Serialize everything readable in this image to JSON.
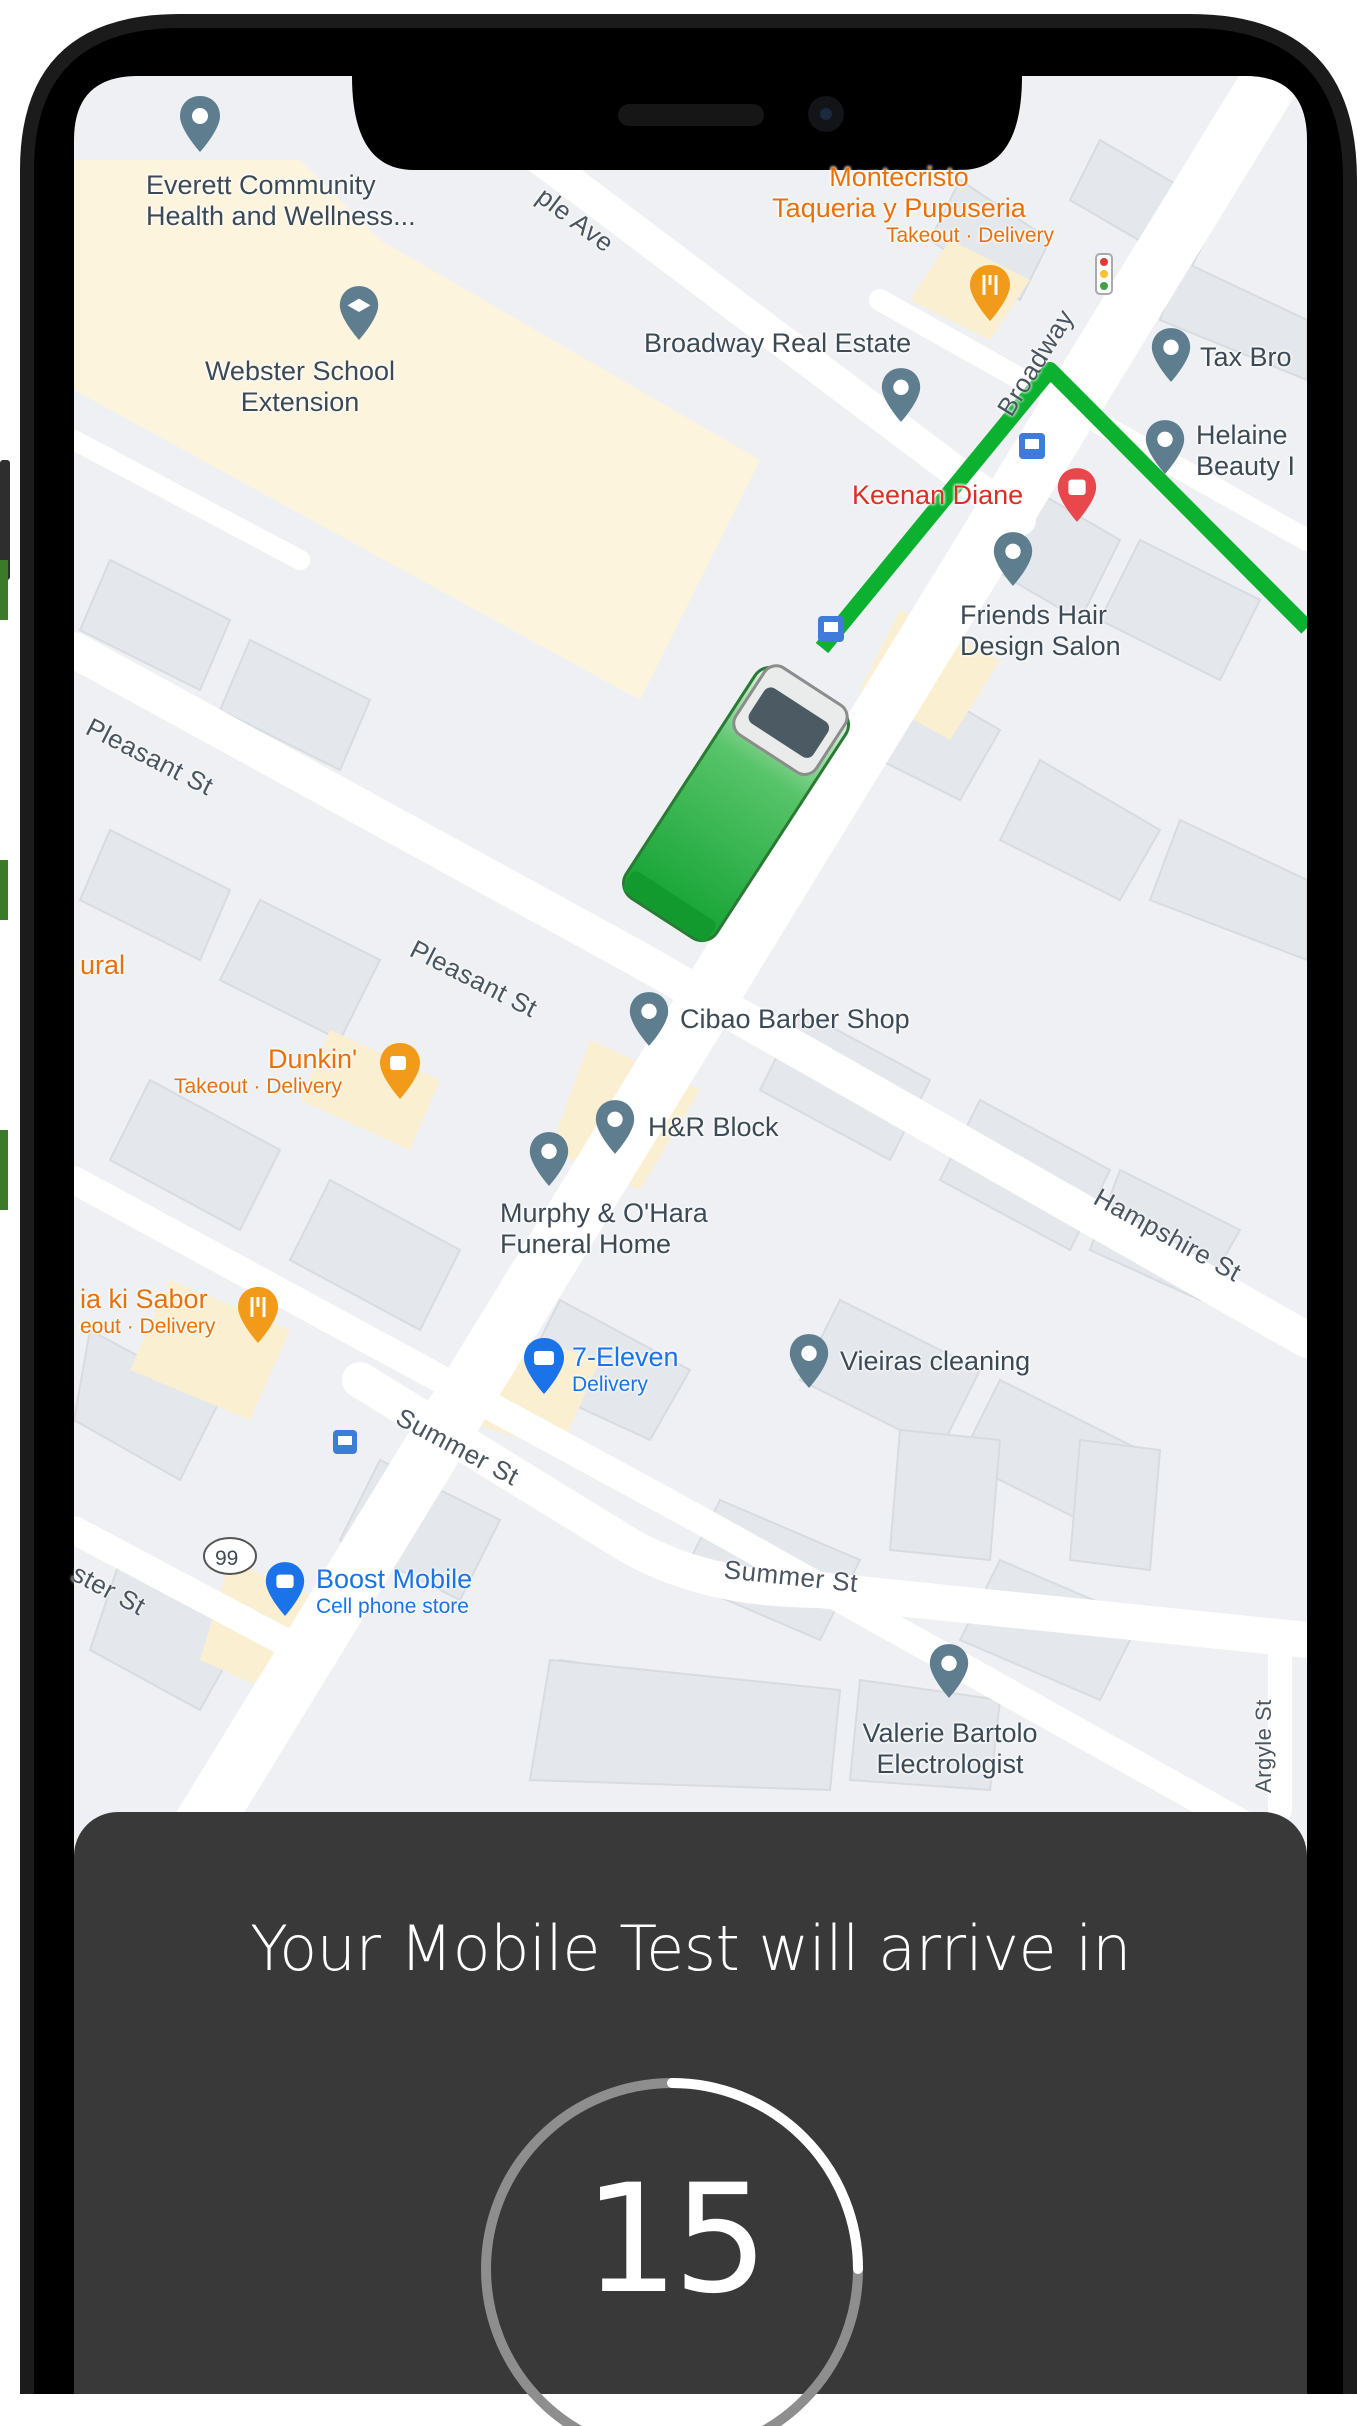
{
  "map": {
    "places": {
      "everett": [
        "Everett Community",
        "Health and Wellness..."
      ],
      "montecristo": [
        "Montecristo",
        "Taqueria y Pupuseria"
      ],
      "montecristo_sub": "Takeout · Delivery",
      "webster": [
        "Webster School",
        "Extension"
      ],
      "broadway_real_estate": "Broadway Real Estate",
      "tax": "Tax Bro",
      "helaine": [
        "Helaine",
        "Beauty I"
      ],
      "keenan": "Keenan Diane",
      "friends_hair": [
        "Friends Hair",
        "Design Salon"
      ],
      "rural": "ural",
      "dunkin": "Dunkin'",
      "dunkin_sub": "Takeout · Delivery",
      "cibao": "Cibao Barber Shop",
      "hr_block": "H&R Block",
      "murphy": [
        "Murphy & O'Hara",
        "Funeral Home"
      ],
      "sabor": "ia ki Sabor",
      "sabor_sub": "eout · Delivery",
      "seven_eleven": "7-Eleven",
      "seven_eleven_sub": "Delivery",
      "vieiras": "Vieiras cleaning",
      "boost": "Boost Mobile",
      "boost_sub": "Cell phone store",
      "valerie": [
        "Valerie Bartolo",
        "Electrologist"
      ],
      "route_99": "99"
    },
    "streets": {
      "maple": "ple Ave",
      "broadway": "Broadway",
      "pleasant_1": "Pleasant St",
      "pleasant_2": "Pleasant St",
      "hampshire": "Hampshire St",
      "summer_1": "Summer St",
      "summer_2": "Summer St",
      "argyle": "Argyle St",
      "ster": "ster St"
    },
    "colors": {
      "route": "#0cb130",
      "vehicle": "#1db33c",
      "pin": "#5e7d8e",
      "food_pin": "#f29b1a",
      "shop_pin": "#1a73e8",
      "health_pin": "#e8474c"
    }
  },
  "panel": {
    "title": "Your Mobile Test will arrive in",
    "countdown": "15",
    "countdown_progress": 0.25
  }
}
